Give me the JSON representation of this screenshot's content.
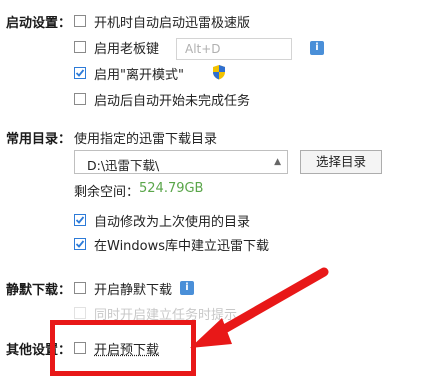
{
  "startup": {
    "label": "启动设置：",
    "opt_boot": "开机时自动启动迅雷极速版",
    "opt_boss_key": "启用老板键",
    "boss_key_value": "Alt+D",
    "opt_away_mode": "启用\"离开模式\"",
    "opt_resume_tasks": "启动后自动开始未完成任务"
  },
  "common_dir": {
    "label": "常用目录：",
    "desc": "使用指定的迅雷下载目录",
    "path": "D:\\迅雷下载\\",
    "select_button": "选择目录",
    "space_label": "剩余空间：",
    "space_value": "524.79GB",
    "opt_last_used": "自动修改为上次使用的目录",
    "opt_windows_lib": "在Windows库中建立迅雷下载"
  },
  "silent": {
    "label": "静默下载：",
    "opt_enable": "开启静默下载",
    "opt_hint": "同时开启建立任务时提示"
  },
  "other": {
    "label": "其他设置：",
    "opt_predownload": "开启预下载"
  },
  "colors": {
    "annotation_red": "#e81818",
    "check_blue": "#2d7bd8",
    "space_green": "#5aa64a"
  }
}
